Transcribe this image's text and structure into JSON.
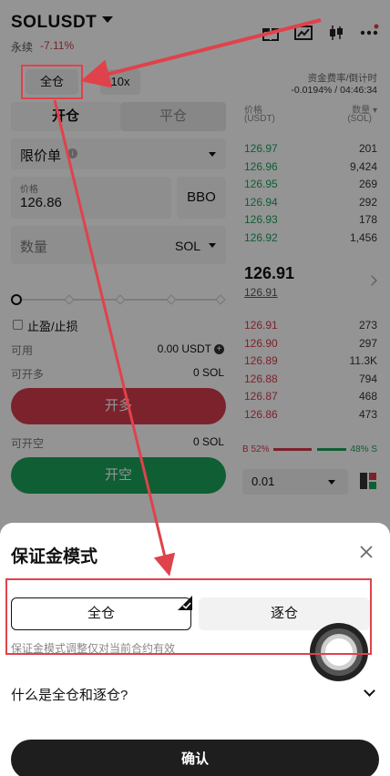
{
  "header": {
    "symbol": "SOLUSDT",
    "contract_type": "永续",
    "change": "-7.11%",
    "icons": [
      "gift-icon",
      "chart-icon",
      "candlestick-icon",
      "more-icon"
    ]
  },
  "controls": {
    "margin_mode": "全仓",
    "leverage": "10x",
    "funding_label": "资金费率/倒计时",
    "funding_value": "-0.0194% / 04:46:34"
  },
  "order_form": {
    "tab_open": "开仓",
    "tab_close": "平仓",
    "order_type": "限价单",
    "price_label": "价格",
    "price_value": "126.86",
    "bbo_label": "BBO",
    "qty_label": "数量",
    "qty_unit": "SOL",
    "tpsl_label": "止盈/止损",
    "available_label": "可用",
    "available_value": "0.00 USDT",
    "max_long_label": "可开多",
    "max_long_value": "0 SOL",
    "max_short_label": "可开空",
    "max_short_value": "0 SOL",
    "long_button": "开多",
    "short_button": "开空",
    "slider_percent": 0
  },
  "order_book": {
    "header_price": "价格",
    "header_price_unit": "(USDT)",
    "header_qty": "数量",
    "header_qty_unit": "(SOL)",
    "asks": [
      {
        "price": "126.97",
        "qty": "201"
      },
      {
        "price": "126.96",
        "qty": "9,424"
      },
      {
        "price": "126.95",
        "qty": "269"
      },
      {
        "price": "126.94",
        "qty": "292"
      },
      {
        "price": "126.93",
        "qty": "178"
      },
      {
        "price": "126.92",
        "qty": "1,456"
      }
    ],
    "mid_price": "126.91",
    "mark_price": "126.91",
    "bids": [
      {
        "price": "126.91",
        "qty": "273"
      },
      {
        "price": "126.90",
        "qty": "297"
      },
      {
        "price": "126.89",
        "qty": "11.3K"
      },
      {
        "price": "126.88",
        "qty": "794"
      },
      {
        "price": "126.87",
        "qty": "468"
      },
      {
        "price": "126.86",
        "qty": "473"
      }
    ],
    "buy_ratio": "B 52%",
    "sell_ratio": "48% S",
    "depth": "0.01"
  },
  "sheet": {
    "title": "保证金模式",
    "option_cross": "全仓",
    "option_isolated": "逐仓",
    "note": "保证金模式调整仅对当前合约有效",
    "faq": "什么是全仓和逐仓?",
    "confirm": "确认"
  },
  "colors": {
    "green": "#1aa35a",
    "red": "#d53b4d",
    "annotation": "#e0424b"
  }
}
